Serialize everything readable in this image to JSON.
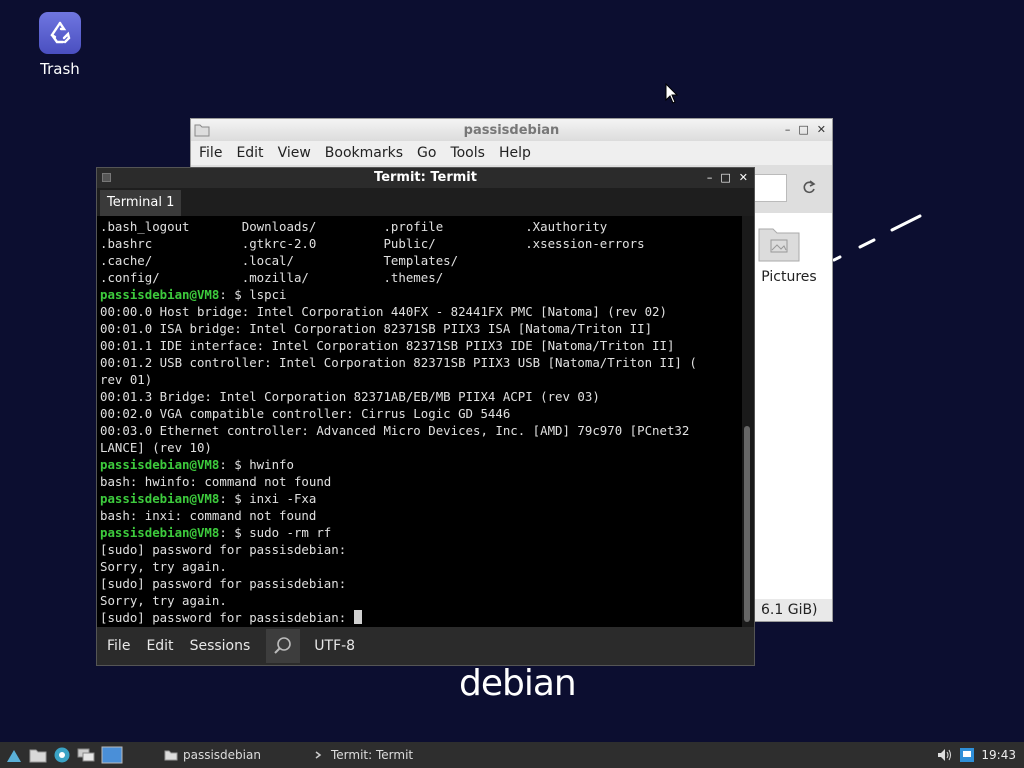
{
  "desktop": {
    "trash_label": "Trash",
    "logo_text": "debian"
  },
  "file_manager": {
    "title": "passisdebian",
    "menu": [
      "File",
      "Edit",
      "View",
      "Bookmarks",
      "Go",
      "Tools",
      "Help"
    ],
    "item_label": "Pictures",
    "status_text": "6.1 GiB)"
  },
  "terminal": {
    "title": "Termit: Termit",
    "tab_label": "Terminal 1",
    "menu": [
      "File",
      "Edit",
      "Sessions"
    ],
    "encoding": "UTF-8",
    "lines": [
      {
        "text": ".bash_logout       Downloads/         .profile           .Xauthority"
      },
      {
        "text": ".bashrc            .gtkrc-2.0         Public/            .xsession-errors"
      },
      {
        "text": ".cache/            .local/            Templates/"
      },
      {
        "text": ".config/           .mozilla/          .themes/"
      },
      {
        "prompt": "passisdebian@VM8",
        "text": ": $ lspci"
      },
      {
        "text": "00:00.0 Host bridge: Intel Corporation 440FX - 82441FX PMC [Natoma] (rev 02)"
      },
      {
        "text": "00:01.0 ISA bridge: Intel Corporation 82371SB PIIX3 ISA [Natoma/Triton II]"
      },
      {
        "text": "00:01.1 IDE interface: Intel Corporation 82371SB PIIX3 IDE [Natoma/Triton II]"
      },
      {
        "text": "00:01.2 USB controller: Intel Corporation 82371SB PIIX3 USB [Natoma/Triton II] ("
      },
      {
        "text": "rev 01)"
      },
      {
        "text": "00:01.3 Bridge: Intel Corporation 82371AB/EB/MB PIIX4 ACPI (rev 03)"
      },
      {
        "text": "00:02.0 VGA compatible controller: Cirrus Logic GD 5446"
      },
      {
        "text": "00:03.0 Ethernet controller: Advanced Micro Devices, Inc. [AMD] 79c970 [PCnet32"
      },
      {
        "text": "LANCE] (rev 10)"
      },
      {
        "prompt": "passisdebian@VM8",
        "text": ": $ hwinfo"
      },
      {
        "text": "bash: hwinfo: command not found"
      },
      {
        "prompt": "passisdebian@VM8",
        "text": ": $ inxi -Fxa"
      },
      {
        "text": "bash: inxi: command not found"
      },
      {
        "prompt": "passisdebian@VM8",
        "text": ": $ sudo -rm rf"
      },
      {
        "text": "[sudo] password for passisdebian:"
      },
      {
        "text": "Sorry, try again."
      },
      {
        "text": "[sudo] password for passisdebian:"
      },
      {
        "text": "Sorry, try again."
      },
      {
        "text": "[sudo] password for passisdebian: ",
        "cursor": true
      }
    ]
  },
  "taskbar": {
    "tasks": [
      {
        "label": "passisdebian"
      },
      {
        "label": "Termit: Termit"
      }
    ],
    "clock": "19:43"
  }
}
